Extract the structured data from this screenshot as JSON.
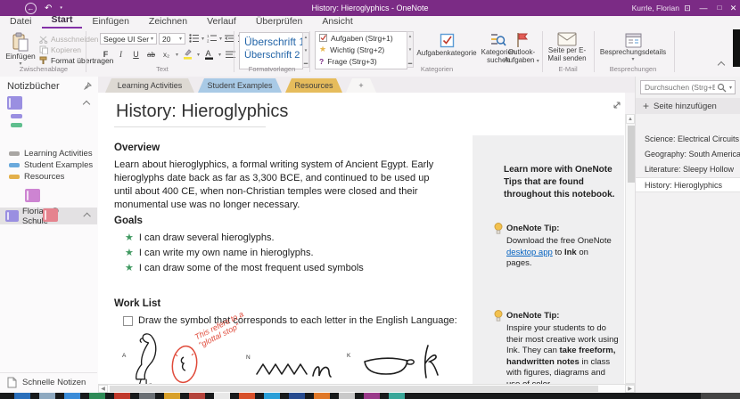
{
  "titlebar": {
    "title": "History: Hieroglyphics - OneNote",
    "user": "Kurrle, Florian"
  },
  "menu": {
    "items": [
      "Datei",
      "Start",
      "Einfügen",
      "Zeichnen",
      "Verlauf",
      "Überprüfen",
      "Ansicht"
    ]
  },
  "ribbon": {
    "paste": "Einfügen",
    "cut": "Ausschneiden",
    "copy": "Kopieren",
    "format_painter": "Format übertragen",
    "group_clipboard": "Zwischenablage",
    "font_name": "Segoe UI Ser",
    "font_size": "20",
    "group_text": "Text",
    "style1": "Überschrift 1",
    "style2": "Überschrift 2",
    "group_styles": "Formatvorlagen",
    "tags": [
      "Aufgaben (Strg+1)",
      "Wichtig (Strg+2)",
      "Frage (Strg+3)"
    ],
    "tag_category": "Aufgabenkategorie",
    "find_tags_line1": "Kategorien",
    "find_tags_line2": "suchen",
    "outlook_line1": "Outlook-",
    "outlook_line2": "Aufgaben",
    "group_tags": "Kategorien",
    "email_line1": "Seite per E-",
    "email_line2": "Mail senden",
    "group_email": "E-Mail",
    "meeting_details": "Besprechungsdetails",
    "group_meetings": "Besprechungen"
  },
  "notebooks": {
    "header": "Notizbücher",
    "active": "Florian @ Schule",
    "sections": [
      "Learning Activities",
      "Student Examples",
      "Resources"
    ],
    "quick_notes": "Schnelle Notizen"
  },
  "tabs": {
    "items": [
      "Learning Activities",
      "Student Examples",
      "Resources",
      "+"
    ]
  },
  "page": {
    "title": "History: Hieroglyphics",
    "overview_heading": "Overview",
    "overview_text": "Learn about hieroglyphics, a formal writing system of Ancient Egypt.  Early hieroglyphs date back as far as 3,300 BCE, and continued to be used up until about 400 CE, when non-Christian temples were closed and their monumental use was no longer necessary.",
    "goals_heading": "Goals",
    "goals": [
      "I can draw several hieroglyphs.",
      "I can write my own name in hieroglyphs.",
      "I can draw some of the most frequent used symbols"
    ],
    "worklist_heading": "Work List",
    "worklist_item": "Draw the symbol that corresponds to each letter in the English Language:",
    "glyph_a": "A",
    "glyph_n": "N",
    "glyph_k": "K",
    "ink_note": "This refers to a \"glottal stop\""
  },
  "tips": {
    "intro": "Learn more with OneNote Tips that are found throughout this notebook.",
    "tip_label": "OneNote Tip:",
    "tip1_p1": "Download the free OneNote ",
    "tip1_link": "desktop app",
    "tip1_p2": " to ",
    "tip1_bold": "Ink",
    "tip1_p3": " on pages.",
    "tip2_p1": "Inspire your students to do their most creative work using Ink. They can ",
    "tip2_bold": "take freeform, handwritten notes",
    "tip2_p2": " in class with figures, diagrams and use of color."
  },
  "pages_panel": {
    "search_placeholder": "Durchsuchen (Strg+E)",
    "add_page": "Seite hinzufügen",
    "pages": [
      "Science: Electrical Circuits",
      "Geography: South America",
      "Literature: Sleepy Hollow",
      "History: Hieroglyphics"
    ]
  },
  "colors": {
    "titlebar_purple": "#7b2b85",
    "accent_purple": "#8331a7",
    "tab_active_gray": "#ddd9d3",
    "tab_students_blue": "#a9cae6",
    "tab_resources_gold": "#e6bc5c",
    "star_green": "#3f9960",
    "ink_red": "#e04a3a",
    "link_blue": "#0563c1",
    "style_blue": "#2365a8"
  }
}
